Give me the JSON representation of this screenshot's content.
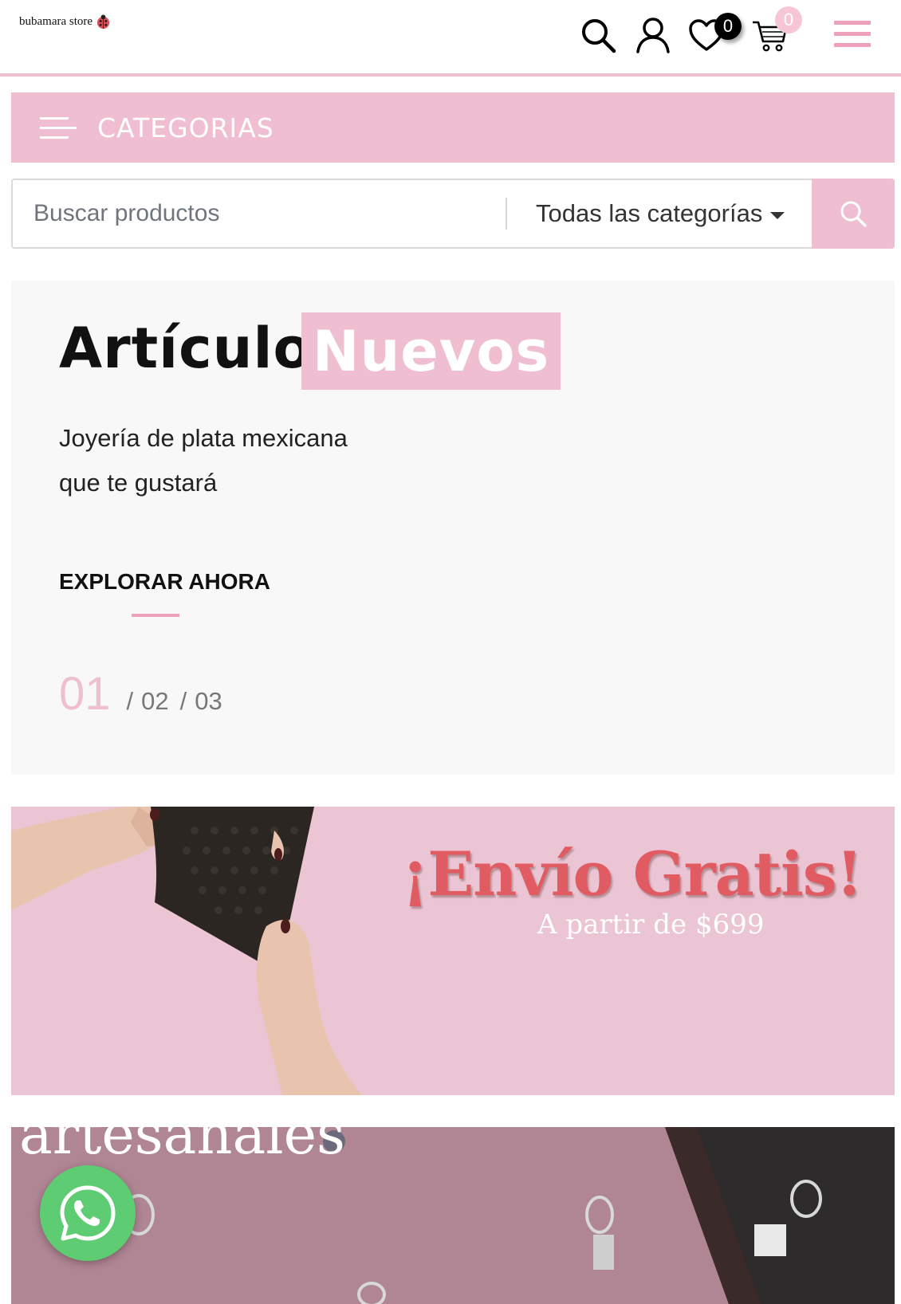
{
  "header": {
    "logo_text": "bubamara store",
    "wishlist_count": "0",
    "cart_count": "0"
  },
  "categories_bar": {
    "label": "CATEGORIAS"
  },
  "search": {
    "placeholder": "Buscar productos",
    "category_selected": "Todas las categorías"
  },
  "hero": {
    "title_part1": "Artículos",
    "title_part2": "Nuevos",
    "subtitle_line1": "Joyería de plata mexicana",
    "subtitle_line2": "que te gustará",
    "cta": "EXPLORAR AHORA",
    "pager": {
      "current": "01",
      "pages": [
        "02",
        "03"
      ]
    }
  },
  "shipping_banner": {
    "title": "¡Envío Gratis!",
    "subtitle": "A partir de $699"
  },
  "artisan_banner": {
    "text": "artesanales"
  },
  "colors": {
    "accent_pink": "#efbfd1",
    "menu_pink": "#eda1bd",
    "whatsapp_green": "#5dcc72",
    "shipping_red": "#e05c62"
  },
  "icons": [
    "ladybug-icon",
    "search-icon",
    "user-icon",
    "heart-icon",
    "cart-icon",
    "menu-icon",
    "whatsapp-icon"
  ]
}
